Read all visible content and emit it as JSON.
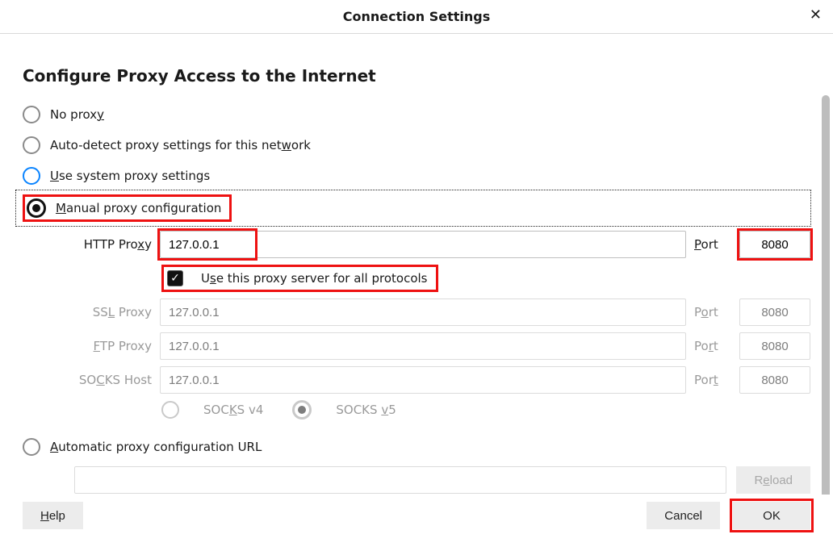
{
  "title": "Connection Settings",
  "section_heading": "Configure Proxy Access to the Internet",
  "radios": {
    "no_proxy": "No proxy",
    "auto_detect": "Auto-detect proxy settings for this network",
    "use_system": "Use system proxy settings",
    "manual": "Manual proxy configuration",
    "auto_url": "Automatic proxy configuration URL"
  },
  "http": {
    "label": "HTTP Proxy",
    "host": "127.0.0.1",
    "port_label": "Port",
    "port": "8080"
  },
  "use_all_label": "Use this proxy server for all protocols",
  "ssl": {
    "label": "SSL Proxy",
    "host": "127.0.0.1",
    "port_label": "Port",
    "port": "8080"
  },
  "ftp": {
    "label": "FTP Proxy",
    "host": "127.0.0.1",
    "port_label": "Port",
    "8080": "8080",
    "port": "8080"
  },
  "socks": {
    "label": "SOCKS Host",
    "host": "127.0.0.1",
    "port_label": "Port",
    "port": "8080"
  },
  "socks_versions": {
    "v4": "SOCKS v4",
    "v5": "SOCKS v5"
  },
  "reload_label": "Reload",
  "footer": {
    "help": "Help",
    "cancel": "Cancel",
    "ok": "OK"
  }
}
